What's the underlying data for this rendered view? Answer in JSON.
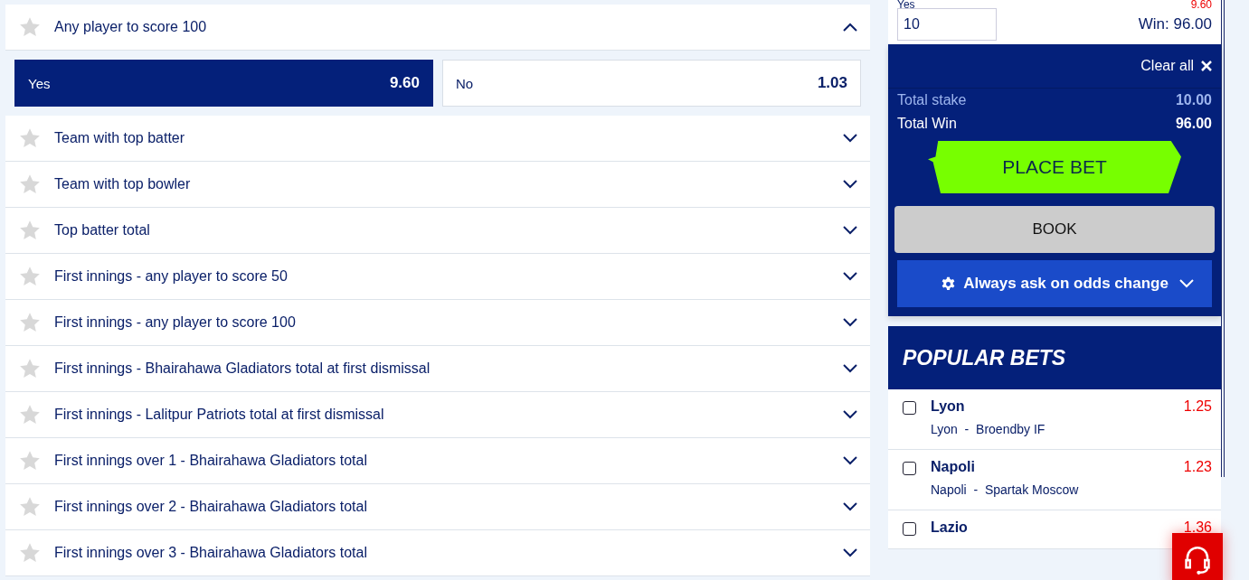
{
  "markets": [
    {
      "title": "Any player to score 100",
      "expanded": true,
      "options": [
        {
          "label": "Yes",
          "odds": "9.60",
          "selected": true
        },
        {
          "label": "No",
          "odds": "1.03",
          "selected": false
        }
      ]
    },
    {
      "title": "Team with top batter",
      "expanded": false
    },
    {
      "title": "Team with top bowler",
      "expanded": false
    },
    {
      "title": "Top batter total",
      "expanded": false
    },
    {
      "title": "First innings - any player to score 50",
      "expanded": false
    },
    {
      "title": "First innings - any player to score 100",
      "expanded": false
    },
    {
      "title": "First innings - Bhairahawa Gladiators total at first dismissal",
      "expanded": false
    },
    {
      "title": "First innings - Lalitpur Patriots total at first dismissal",
      "expanded": false
    },
    {
      "title": "First innings over 1 - Bhairahawa Gladiators total",
      "expanded": false
    },
    {
      "title": "First innings over 2 - Bhairahawa Gladiators total",
      "expanded": false
    },
    {
      "title": "First innings over 3 - Bhairahawa Gladiators total",
      "expanded": false
    }
  ],
  "betslip": {
    "selection": "Yes",
    "odds": "9.60",
    "stake": "10",
    "win": "Win: 96.00",
    "clear_all": "Clear all",
    "total_stake_label": "Total stake",
    "total_stake": "10.00",
    "total_win_label": "Total Win",
    "total_win": "96.00",
    "place_bet": "PLACE BET",
    "book": "BOOK",
    "odds_change": "Always ask on odds change"
  },
  "popular_bets": {
    "title": "POPULAR BETS",
    "items": [
      {
        "name": "Lyon",
        "odds": "1.25",
        "match": "Lyon  -  Broendby IF",
        "checked": false
      },
      {
        "name": "Napoli",
        "odds": "1.23",
        "match": "Napoli  -  Spartak Moscow",
        "checked": false
      },
      {
        "name": "Lazio",
        "odds": "1.36",
        "checked": false
      }
    ]
  }
}
